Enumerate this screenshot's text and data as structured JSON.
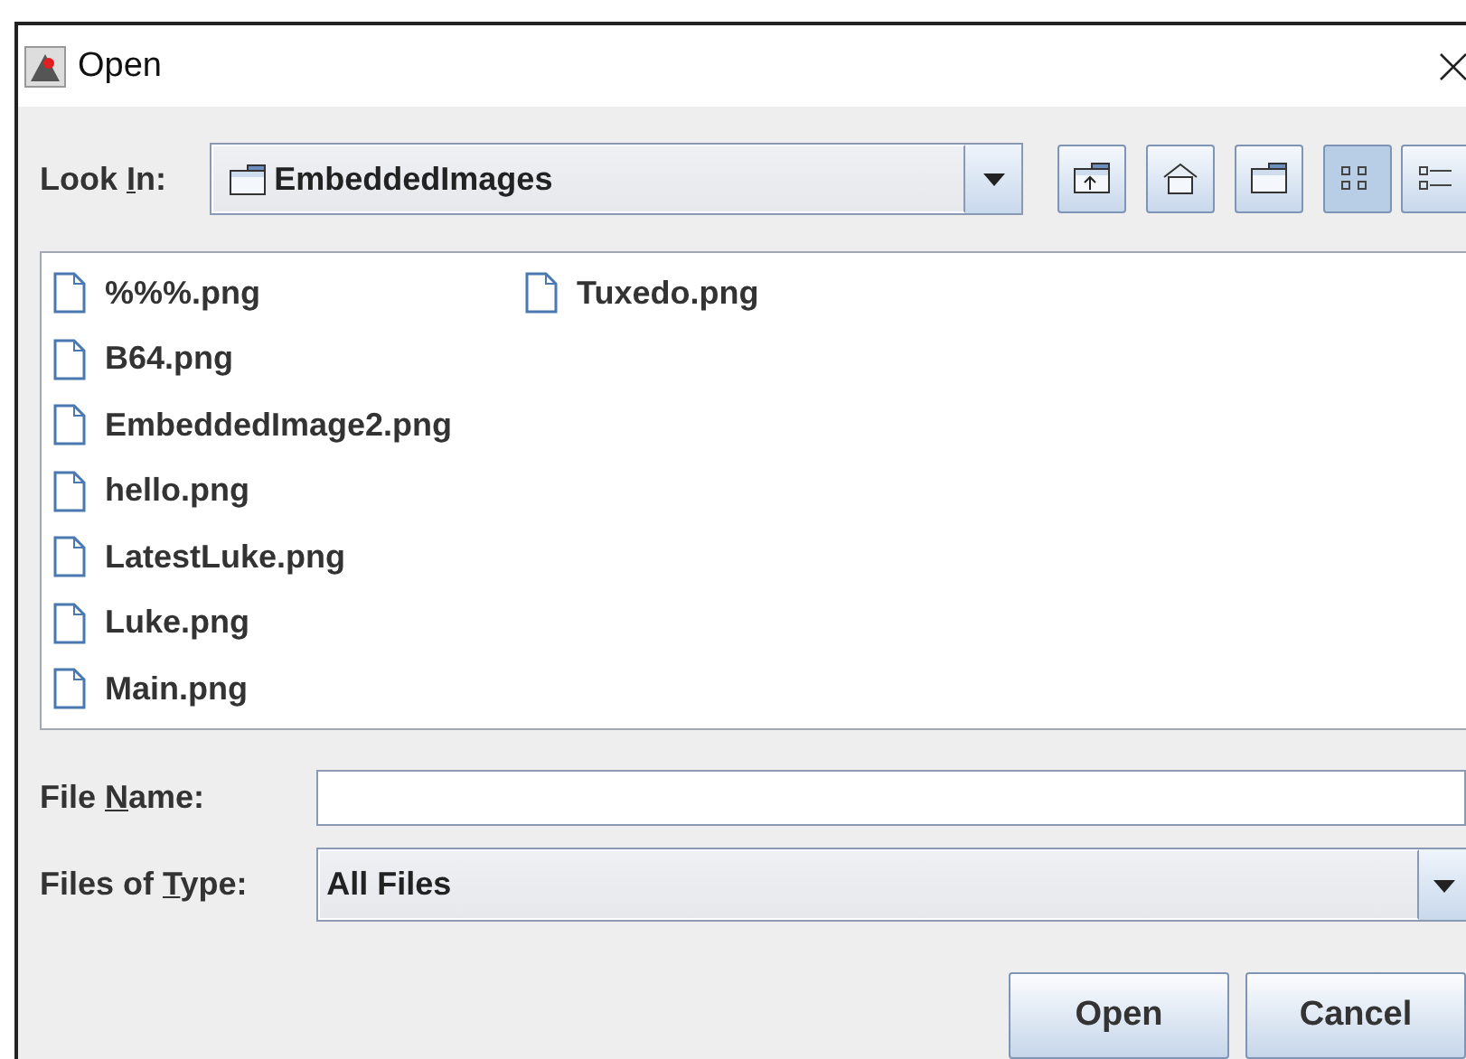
{
  "window": {
    "title": "Open"
  },
  "look_in": {
    "label": {
      "pre": "Look ",
      "key": "I",
      "post": "n:"
    },
    "value": "EmbeddedImages"
  },
  "toolbar": [
    {
      "kind": "up"
    },
    {
      "kind": "home"
    },
    {
      "kind": "new-folder"
    },
    {
      "kind": "list",
      "selected": true
    },
    {
      "kind": "details",
      "selected": false
    }
  ],
  "files": [
    {
      "name": "%%%.png"
    },
    {
      "name": "B64.png"
    },
    {
      "name": "EmbeddedImage2.png"
    },
    {
      "name": "hello.png"
    },
    {
      "name": "LatestLuke.png"
    },
    {
      "name": "Luke.png"
    },
    {
      "name": "Main.png"
    },
    {
      "name": "Tuxedo.png"
    }
  ],
  "file_name": {
    "label": {
      "pre": "File ",
      "key": "N",
      "post": "ame:"
    }
  },
  "file_type": {
    "label": {
      "pre": "Files of ",
      "key": "T",
      "post": "ype:"
    },
    "value": "All Files"
  },
  "buttons": [
    "Open",
    "Cancel"
  ]
}
